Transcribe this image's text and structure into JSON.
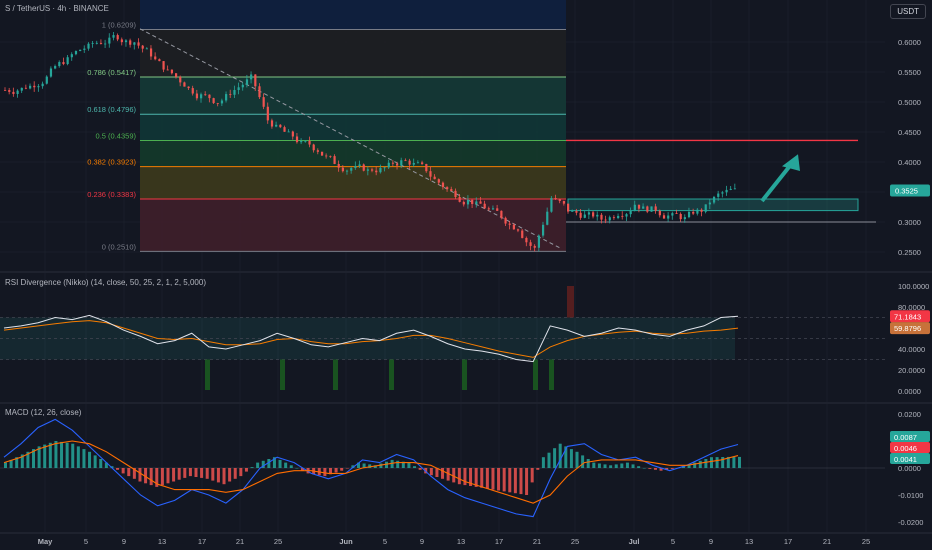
{
  "header": {
    "title": "S / TetherUS · 4h · BINANCE",
    "currency": "USDT"
  },
  "colors": {
    "up": "#26a69a",
    "down": "#ef5350",
    "bg": "#131722",
    "grid": "#1f2430",
    "text": "#b2b5be"
  },
  "fib": {
    "levels": [
      {
        "label": "1 (0.6209)",
        "price": 0.6209,
        "color": "#787b86"
      },
      {
        "label": "0.786 (0.5417)",
        "price": 0.5417,
        "color": "#81c784"
      },
      {
        "label": "0.618 (0.4796)",
        "price": 0.4796,
        "color": "#4db6ac"
      },
      {
        "label": "0.5 (0.4359)",
        "price": 0.4359,
        "color": "#4caf50"
      },
      {
        "label": "0.382 (0.3923)",
        "price": 0.3923,
        "color": "#f57c00"
      },
      {
        "label": "0.236 (0.3383)",
        "price": 0.3383,
        "color": "#f23645"
      },
      {
        "label": "0 (0.2510)",
        "price": 0.251,
        "color": "#787b86"
      }
    ]
  },
  "price_axis": {
    "ticks": [
      "0.6000",
      "0.5500",
      "0.5000",
      "0.4500",
      "0.4000",
      "0.3500",
      "0.3000",
      "0.2500"
    ],
    "current": "0.3525"
  },
  "rsi": {
    "title": "RSI Divergence (Nikko) (14, close, 50, 25, 2, 1, 2, 5,000)",
    "ticks": [
      "100.0000",
      "80.0000",
      "60.0000",
      "40.0000",
      "20.0000",
      "0.0000"
    ],
    "badges": [
      "71.1843",
      "59.8796"
    ]
  },
  "macd": {
    "title": "MACD (12, 26, close)",
    "ticks": [
      "0.0200",
      "0.0100",
      "0.0000",
      "-0.0100",
      "-0.0200"
    ],
    "badges": [
      "0.0087",
      "0.0046",
      "0.0041"
    ]
  },
  "time_axis": [
    "May",
    "5",
    "9",
    "13",
    "17",
    "21",
    "25",
    "Jun",
    "5",
    "9",
    "13",
    "17",
    "21",
    "25",
    "Jul",
    "5",
    "9",
    "13",
    "17",
    "21",
    "25"
  ],
  "chart_data": [
    {
      "type": "candlestick",
      "title": "S / TetherUS · 4h · BINANCE",
      "ylim": [
        0.235,
        0.645
      ],
      "x": [
        "May",
        "5",
        "9",
        "13",
        "17",
        "21",
        "25",
        "Jun",
        "5",
        "9",
        "13",
        "17",
        "21",
        "25",
        "Jul",
        "5",
        "9",
        "13",
        "17",
        "21",
        "25"
      ],
      "series": [
        {
          "values": [
            0.52,
            0.53,
            0.55,
            0.57,
            0.59,
            0.6,
            0.61,
            0.6,
            0.58,
            0.55,
            0.53,
            0.51,
            0.5,
            0.52,
            0.54,
            0.47,
            0.45,
            0.43,
            0.42,
            0.4,
            0.39,
            0.385,
            0.39,
            0.4,
            0.395,
            0.37,
            0.35,
            0.335,
            0.325,
            0.31,
            0.29,
            0.255,
            0.34,
            0.32,
            0.31,
            0.305,
            0.315,
            0.33,
            0.32,
            0.31,
            0.305,
            0.32,
            0.345,
            0.3525
          ]
        }
      ],
      "annotations": [
        "Fibonacci retracement 1 (0.6209) to 0 (0.2510)",
        "resistance line 0.4359",
        "support zone 0.315-0.335",
        "green arrow up"
      ]
    },
    {
      "type": "line",
      "title": "RSI Divergence (Nikko) (14, close, 50, 25, 2, 1, 2, 5,000)",
      "ylim": [
        0,
        100
      ],
      "series": [
        {
          "values": [
            60,
            62,
            65,
            70,
            68,
            72,
            66,
            58,
            52,
            45,
            48,
            55,
            42,
            40,
            44,
            48,
            55,
            50,
            44,
            42,
            46,
            50,
            48,
            55,
            58,
            52,
            45,
            40,
            38,
            35,
            30,
            28,
            62,
            58,
            52,
            55,
            60,
            58,
            54,
            52,
            58,
            62,
            70,
            71.1843
          ]
        },
        {
          "name": "",
          "values": [
            58,
            60,
            62,
            64,
            66,
            67,
            65,
            60,
            55,
            50,
            49,
            50,
            47,
            44,
            44,
            45,
            49,
            50,
            47,
            45,
            45,
            47,
            48,
            50,
            53,
            53,
            50,
            46,
            42,
            38,
            35,
            32,
            42,
            48,
            52,
            54,
            56,
            57,
            55,
            54,
            55,
            57,
            58,
            59.8796
          ]
        }
      ]
    },
    {
      "type": "bar",
      "title": "MACD (12, 26, close)",
      "ylim": [
        -0.024,
        0.024
      ],
      "series": [
        {
          "name": "",
          "values": [
            0.002,
            0.005,
            0.008,
            0.01,
            0.009,
            0.006,
            0.002,
            -0.002,
            -0.005,
            -0.007,
            -0.005,
            -0.003,
            -0.004,
            -0.006,
            -0.003,
            0.002,
            0.004,
            0.001,
            -0.002,
            -0.003,
            -0.001,
            0.002,
            0.001,
            0.003,
            0.002,
            -0.002,
            -0.004,
            -0.006,
            -0.007,
            -0.008,
            -0.009,
            -0.01,
            0.004,
            0.009,
            0.006,
            0.002,
            0.001,
            0.002,
            0.0,
            -0.001,
            0.0,
            0.002,
            0.004,
            0.0041
          ]
        },
        {
          "name": "",
          "values": [
            0.004,
            0.009,
            0.015,
            0.018,
            0.014,
            0.008,
            0.002,
            -0.004,
            -0.01,
            -0.014,
            -0.012,
            -0.008,
            -0.01,
            -0.013,
            -0.008,
            0.0,
            0.004,
            0.002,
            -0.002,
            -0.004,
            -0.002,
            0.003,
            0.002,
            0.005,
            0.003,
            -0.003,
            -0.008,
            -0.011,
            -0.013,
            -0.015,
            -0.017,
            -0.018,
            -0.004,
            0.008,
            0.009,
            0.005,
            0.003,
            0.004,
            0.001,
            -0.001,
            0.001,
            0.004,
            0.007,
            0.0087
          ]
        },
        {
          "name": "",
          "values": [
            0.002,
            0.004,
            0.007,
            0.009,
            0.01,
            0.009,
            0.006,
            0.002,
            -0.002,
            -0.006,
            -0.008,
            -0.008,
            -0.008,
            -0.009,
            -0.008,
            -0.005,
            -0.002,
            -0.001,
            -0.001,
            -0.002,
            -0.002,
            0.0,
            0.001,
            0.002,
            0.002,
            0.001,
            -0.002,
            -0.005,
            -0.007,
            -0.009,
            -0.011,
            -0.013,
            -0.01,
            -0.003,
            0.002,
            0.003,
            0.003,
            0.003,
            0.002,
            0.001,
            0.001,
            0.002,
            0.003,
            0.0046
          ]
        }
      ]
    }
  ]
}
